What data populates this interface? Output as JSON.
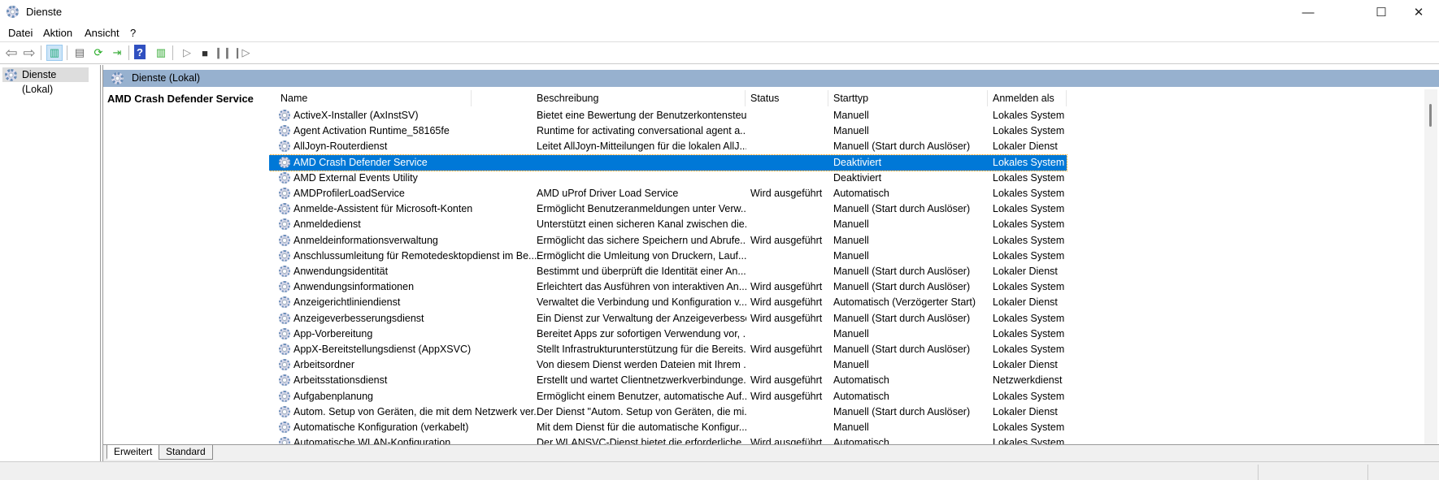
{
  "window": {
    "title": "Dienste",
    "minimize": "—",
    "maximize": "☐",
    "close": "✕"
  },
  "menu": [
    "Datei",
    "Aktion",
    "Ansicht",
    "?"
  ],
  "toolbar": [
    "back-icon",
    "forward-icon",
    "show-hide-tree-icon",
    "properties-icon",
    "refresh-icon",
    "export-list-icon",
    "help-icon",
    "show-action-pane-icon",
    "start-icon",
    "stop-icon",
    "pause-icon",
    "resume-icon"
  ],
  "tree": {
    "root": "Dienste (Lokal)"
  },
  "pane": {
    "header": "Dienste (Lokal)",
    "selected_service": "AMD Crash Defender Service"
  },
  "columns": [
    "Name",
    "Beschreibung",
    "Status",
    "Starttyp",
    "Anmelden als"
  ],
  "sort": {
    "column": "Name",
    "direction": "ascending"
  },
  "rows": [
    [
      "ActiveX-Installer (AxInstSV)",
      "Bietet eine Bewertung der Benutzerkontensteu...",
      "",
      "Manuell",
      "Lokales System"
    ],
    [
      "Agent Activation Runtime_58165fe",
      "Runtime for activating conversational agent a...",
      "",
      "Manuell",
      "Lokales System"
    ],
    [
      "AllJoyn-Routerdienst",
      "Leitet AllJoyn-Mitteilungen für die lokalen AllJ...",
      "",
      "Manuell (Start durch Auslöser)",
      "Lokaler Dienst"
    ],
    [
      "AMD Crash Defender Service",
      "",
      "",
      "Deaktiviert",
      "Lokales System"
    ],
    [
      "AMD External Events Utility",
      "",
      "",
      "Deaktiviert",
      "Lokales System"
    ],
    [
      "AMDProfilerLoadService",
      "AMD uProf Driver Load Service",
      "Wird ausgeführt",
      "Automatisch",
      "Lokales System"
    ],
    [
      "Anmelde-Assistent für Microsoft-Konten",
      "Ermöglicht Benutzeranmeldungen unter Verw...",
      "",
      "Manuell (Start durch Auslöser)",
      "Lokales System"
    ],
    [
      "Anmeldedienst",
      "Unterstützt einen sicheren Kanal zwischen die...",
      "",
      "Manuell",
      "Lokales System"
    ],
    [
      "Anmeldeinformationsverwaltung",
      "Ermöglicht das sichere Speichern und Abrufe...",
      "Wird ausgeführt",
      "Manuell",
      "Lokales System"
    ],
    [
      "Anschlussumleitung für Remotedesktopdienst im Be...",
      "Ermöglicht die Umleitung von Druckern, Lauf...",
      "",
      "Manuell",
      "Lokales System"
    ],
    [
      "Anwendungsidentität",
      "Bestimmt und überprüft die Identität einer An...",
      "",
      "Manuell (Start durch Auslöser)",
      "Lokaler Dienst"
    ],
    [
      "Anwendungsinformationen",
      "Erleichtert das Ausführen von interaktiven An...",
      "Wird ausgeführt",
      "Manuell (Start durch Auslöser)",
      "Lokales System"
    ],
    [
      "Anzeigerichtliniendienst",
      "Verwaltet die Verbindung und Konfiguration v...",
      "Wird ausgeführt",
      "Automatisch (Verzögerter Start)",
      "Lokaler Dienst"
    ],
    [
      "Anzeigeverbesserungsdienst",
      "Ein Dienst zur Verwaltung der Anzeigeverbesse...",
      "Wird ausgeführt",
      "Manuell (Start durch Auslöser)",
      "Lokales System"
    ],
    [
      "App-Vorbereitung",
      "Bereitet Apps zur sofortigen Verwendung vor, ...",
      "",
      "Manuell",
      "Lokales System"
    ],
    [
      "AppX-Bereitstellungsdienst (AppXSVC)",
      "Stellt Infrastrukturunterstützung für die Bereits...",
      "Wird ausgeführt",
      "Manuell (Start durch Auslöser)",
      "Lokales System"
    ],
    [
      "Arbeitsordner",
      "Von diesem Dienst werden Dateien mit Ihrem ...",
      "",
      "Manuell",
      "Lokaler Dienst"
    ],
    [
      "Arbeitsstationsdienst",
      "Erstellt und wartet Clientnetzwerkverbindunge...",
      "Wird ausgeführt",
      "Automatisch",
      "Netzwerkdienst"
    ],
    [
      "Aufgabenplanung",
      "Ermöglicht einem Benutzer, automatische Auf...",
      "Wird ausgeführt",
      "Automatisch",
      "Lokales System"
    ],
    [
      "Autom. Setup von Geräten, die mit dem Netzwerk ver...",
      "Der Dienst \"Autom. Setup von Geräten, die mi...",
      "",
      "Manuell (Start durch Auslöser)",
      "Lokaler Dienst"
    ],
    [
      "Automatische Konfiguration (verkabelt)",
      "Mit dem Dienst für die automatische Konfigur...",
      "",
      "Manuell",
      "Lokales System"
    ],
    [
      "Automatische WLAN-Konfiguration",
      "Der WLANSVC-Dienst bietet die erforderliche ...",
      "Wird ausgeführt",
      "Automatisch",
      "Lokales System"
    ]
  ],
  "selected_row": 3,
  "tabs": [
    "Erweitert",
    "Standard"
  ],
  "colors": {
    "selection": "#0078d7",
    "band": "#97b1cf"
  }
}
